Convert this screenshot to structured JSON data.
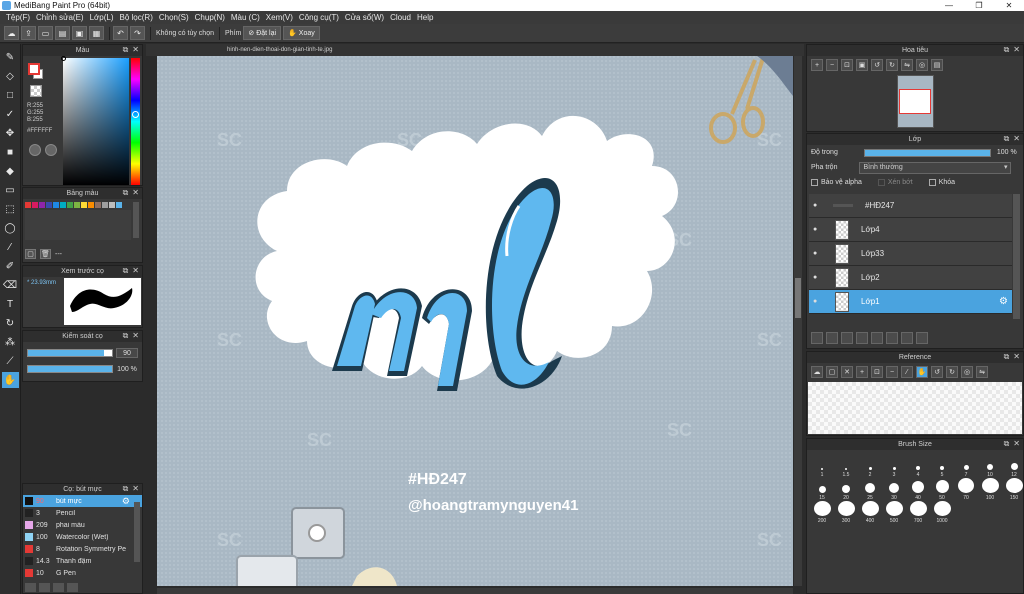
{
  "window": {
    "title": "MediBang Paint Pro (64bit)"
  },
  "menu": [
    "Tệp(F)",
    "Chỉnh sửa(E)",
    "Lớp(L)",
    "Bộ lọc(R)",
    "Chọn(S)",
    "Chụp(N)",
    "Màu (C)",
    "Xem(V)",
    "Công cụ(T)",
    "Cửa sổ(W)",
    "Cloud",
    "Help"
  ],
  "options": {
    "no_selection": "Không có tùy chọn",
    "keys_label": "Phím",
    "reset": "Đặt lại",
    "rotate": "Xoay"
  },
  "color_panel": {
    "title": "Màu",
    "r": "R:255",
    "g": "G:255",
    "b": "B:255",
    "hex": "#FFFFFF",
    "foreground": "#FFFFFF"
  },
  "palette_panel": {
    "title": "Bảng màu",
    "dashes": "---",
    "colors": [
      "#e53935",
      "#d81b60",
      "#8e24aa",
      "#3949ab",
      "#1e88e5",
      "#00acc1",
      "#43a047",
      "#7cb342",
      "#fdd835",
      "#fb8c00",
      "#8d6e63",
      "#9e9e9e",
      "#bdbdbd",
      "#5ab3ea"
    ]
  },
  "preview_panel": {
    "title": "Xem trước cọ",
    "size": "* 23.93mm"
  },
  "control_panel": {
    "title": "Kiểm soát cọ",
    "size_value": "90",
    "opacity_value": "100 %",
    "size_fraction": 0.9,
    "opacity_fraction": 1.0
  },
  "brush_panel": {
    "title": "Cọ: bút mực",
    "brushes": [
      {
        "size": "90",
        "name": "bút mực",
        "color": "#111111"
      },
      {
        "size": "3",
        "name": "Pencil",
        "color": "#222222"
      },
      {
        "size": "209",
        "name": "phai màu",
        "color": "#e5a6e8"
      },
      {
        "size": "100",
        "name": "Watercolor (Wet)",
        "color": "#8fd3f4"
      },
      {
        "size": "8",
        "name": "Rotation Symmetry Pe",
        "color": "#e53935"
      },
      {
        "size": "14.3",
        "name": "Thanh đậm",
        "color": "#222222"
      },
      {
        "size": "10",
        "name": "G Pen",
        "color": "#e53935"
      }
    ]
  },
  "document": {
    "tab": "hinh-nen-dien-thoai-don-gian-tinh-te.jpg"
  },
  "artwork": {
    "tag": "#HĐ247",
    "handle": "@hoangtramynguyen41"
  },
  "navigator": {
    "title": "Hoa tiêu"
  },
  "layer_panel": {
    "title": "Lớp",
    "opacity_label": "Độ trong",
    "opacity_value": "100 %",
    "blend_label": "Pha trộn",
    "blend_value": "Bình thường",
    "protect_alpha": "Bảo vệ alpha",
    "clip": "Xén bớt",
    "lock": "Khóa",
    "layers": [
      {
        "name": "#HĐ247",
        "folder": true,
        "selected": false
      },
      {
        "name": "Lớp4",
        "folder": false,
        "selected": false
      },
      {
        "name": "Lớp33",
        "folder": false,
        "selected": false
      },
      {
        "name": "Lớp2",
        "folder": false,
        "selected": false
      },
      {
        "name": "Lớp1",
        "folder": false,
        "selected": true
      }
    ]
  },
  "reference_panel": {
    "title": "Reference"
  },
  "brush_size_panel": {
    "title": "Brush Size",
    "sizes": [
      "1",
      "1.5",
      "2",
      "3",
      "4",
      "5",
      "7",
      "10",
      "12",
      "15",
      "20",
      "25",
      "30",
      "40",
      "50",
      "70",
      "100",
      "150",
      "200",
      "300",
      "400",
      "500",
      "700",
      "1000"
    ]
  }
}
